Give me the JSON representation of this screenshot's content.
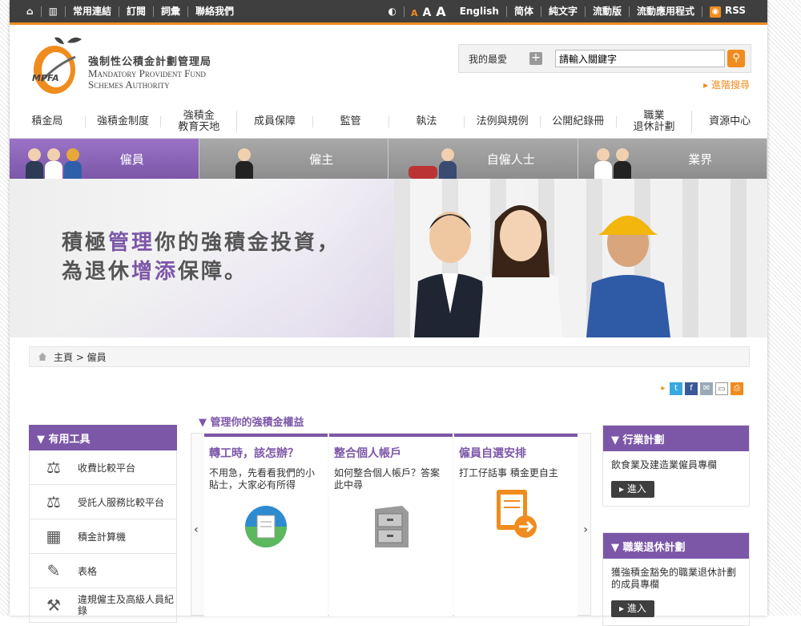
{
  "topbar": {
    "left": [
      "常用連結",
      "訂閱",
      "詞彙",
      "聯絡我們"
    ],
    "font_sizes": [
      "A",
      "A",
      "A"
    ],
    "right": [
      "English",
      "简体",
      "純文字",
      "流動版",
      "流動應用程式",
      "RSS"
    ]
  },
  "header": {
    "logo_text": "MPFA",
    "org_zh": "強制性公積金計劃管理局",
    "org_en1": "Mandatory Provident Fund",
    "org_en2": "Schemes Authority",
    "favorites": "我的最愛",
    "search_value": "請輸入關鍵字",
    "advanced_search": "▸ 進階搜尋"
  },
  "mainnav": [
    "積金局",
    "強積金制度",
    "強積金\n教育天地",
    "成員保障",
    "監管",
    "執法",
    "法例與規例",
    "公開紀錄冊",
    "職業\n退休計劃",
    "資源中心"
  ],
  "tabs": [
    "僱員",
    "僱主",
    "自僱人士",
    "業界"
  ],
  "banner": {
    "line1_a": "積極",
    "line1_hl": "管理",
    "line1_b": "你的強積金投資，",
    "line2_a": "為退休",
    "line2_hl": "增添",
    "line2_b": "保障。"
  },
  "breadcrumb": "主頁 > 僱員",
  "tools": {
    "title": "▼  有用工具",
    "items": [
      "收費比較平台",
      "受託人服務比較平台",
      "積金計算機",
      "表格",
      "違規僱主及高級人員紀錄"
    ]
  },
  "center": {
    "title": "▼  管理你的強積金權益",
    "cards": [
      {
        "title": "轉工時，該怎辦？",
        "text": "不用急，先看看我們的小貼士，大家必有所得"
      },
      {
        "title": "整合個人帳戶",
        "text": "如何整合個人帳戶？答案此中尋"
      },
      {
        "title": "僱員自選安排",
        "text": "打工仔話事 積金更自主"
      }
    ]
  },
  "right": {
    "p1_title": "▼  行業計劃",
    "p1_text": "飲食業及建造業僱員專欄",
    "p2_title": "▼  職業退休計劃",
    "p2_text": "獲強積金豁免的職業退休計劃的成員專欄",
    "enter": "▸ 進入"
  },
  "colors": {
    "accent": "#7c57a8",
    "orange": "#f08c1e",
    "dark": "#3f3f3f"
  }
}
